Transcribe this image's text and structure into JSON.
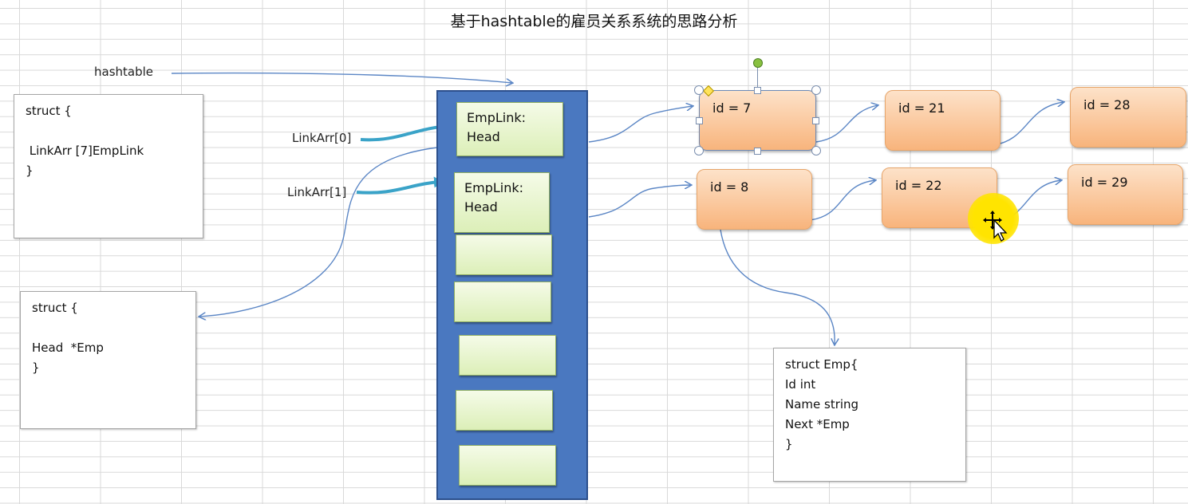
{
  "title": "基于hashtable的雇员关系系统的思路分析",
  "labels": {
    "hashtable": "hashtable",
    "link0": "LinkArr[0]",
    "link1": "LinkArr[1]"
  },
  "struct_hashtable": [
    "struct {",
    "",
    " LinkArr [7]EmpLink",
    "}"
  ],
  "struct_emplink": [
    "struct {",
    "",
    "Head  *Emp",
    "}"
  ],
  "struct_emp": [
    "struct Emp{",
    "Id int",
    "Name string",
    "Next *Emp",
    "}"
  ],
  "buckets": [
    {
      "line1": "EmpLink:",
      "line2": "Head"
    },
    {
      "line1": "EmpLink:",
      "line2": "Head"
    },
    {
      "line1": "",
      "line2": ""
    },
    {
      "line1": "",
      "line2": ""
    },
    {
      "line1": "",
      "line2": ""
    },
    {
      "line1": "",
      "line2": ""
    },
    {
      "line1": "",
      "line2": ""
    }
  ],
  "rows": [
    [
      "id  = 7",
      "id = 21",
      "id = 28"
    ],
    [
      "id  = 8",
      "id = 22",
      "id = 29"
    ]
  ],
  "colors": {
    "bucket_column": "#4a78c0",
    "bucket_cell": "#dcefb8",
    "node": "#f8b47c",
    "arrow": "#5b86c5",
    "thick_arrow": "#3aa3c8",
    "cursor_highlight": "#ffe400"
  }
}
